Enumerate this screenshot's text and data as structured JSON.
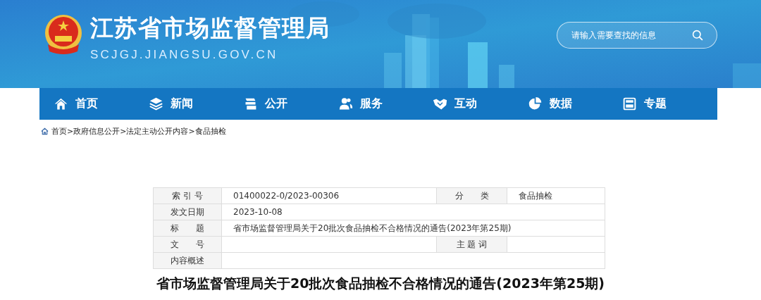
{
  "header": {
    "title": "江苏省市场监督管理局",
    "domain": "SCJGJ.JIANGSU.GOV.CN",
    "search": {
      "placeholder": "请输入需要查找的信息"
    }
  },
  "nav": [
    {
      "label": "首页"
    },
    {
      "label": "新闻"
    },
    {
      "label": "公开"
    },
    {
      "label": "服务"
    },
    {
      "label": "互动"
    },
    {
      "label": "数据"
    },
    {
      "label": "专题"
    }
  ],
  "breadcrumb": {
    "items": [
      "首页",
      "政府信息公开",
      "法定主动公开内容",
      "食品抽检"
    ],
    "separator": ">"
  },
  "meta_table": {
    "rows": [
      {
        "cells": [
          {
            "kind": "label",
            "text": "索 引 号"
          },
          {
            "kind": "value",
            "text": "01400022-0/2023-00306"
          },
          {
            "kind": "label",
            "text": "分　　类"
          },
          {
            "kind": "value",
            "text": "食品抽检"
          }
        ]
      },
      {
        "cells": [
          {
            "kind": "label",
            "text": "发文日期"
          },
          {
            "kind": "value",
            "text": "2023-10-08",
            "colspan": 3
          }
        ]
      },
      {
        "cells": [
          {
            "kind": "label",
            "text": "标　　题"
          },
          {
            "kind": "value",
            "colspan": 3,
            "text": "省市场监督管理局关于20批次食品抽检不合格情况的通告(2023年第25期)"
          }
        ]
      },
      {
        "cells": [
          {
            "kind": "label",
            "text": "文　　号"
          },
          {
            "kind": "value"
          },
          {
            "kind": "label",
            "text": "主 题 词"
          },
          {
            "kind": "value"
          }
        ]
      },
      {
        "cells": [
          {
            "kind": "label",
            "text": "内容概述"
          },
          {
            "kind": "value",
            "colspan": 3
          }
        ]
      }
    ]
  },
  "article": {
    "title": "省市场监督管理局关于20批次食品抽检不合格情况的通告(2023年第25期)"
  }
}
